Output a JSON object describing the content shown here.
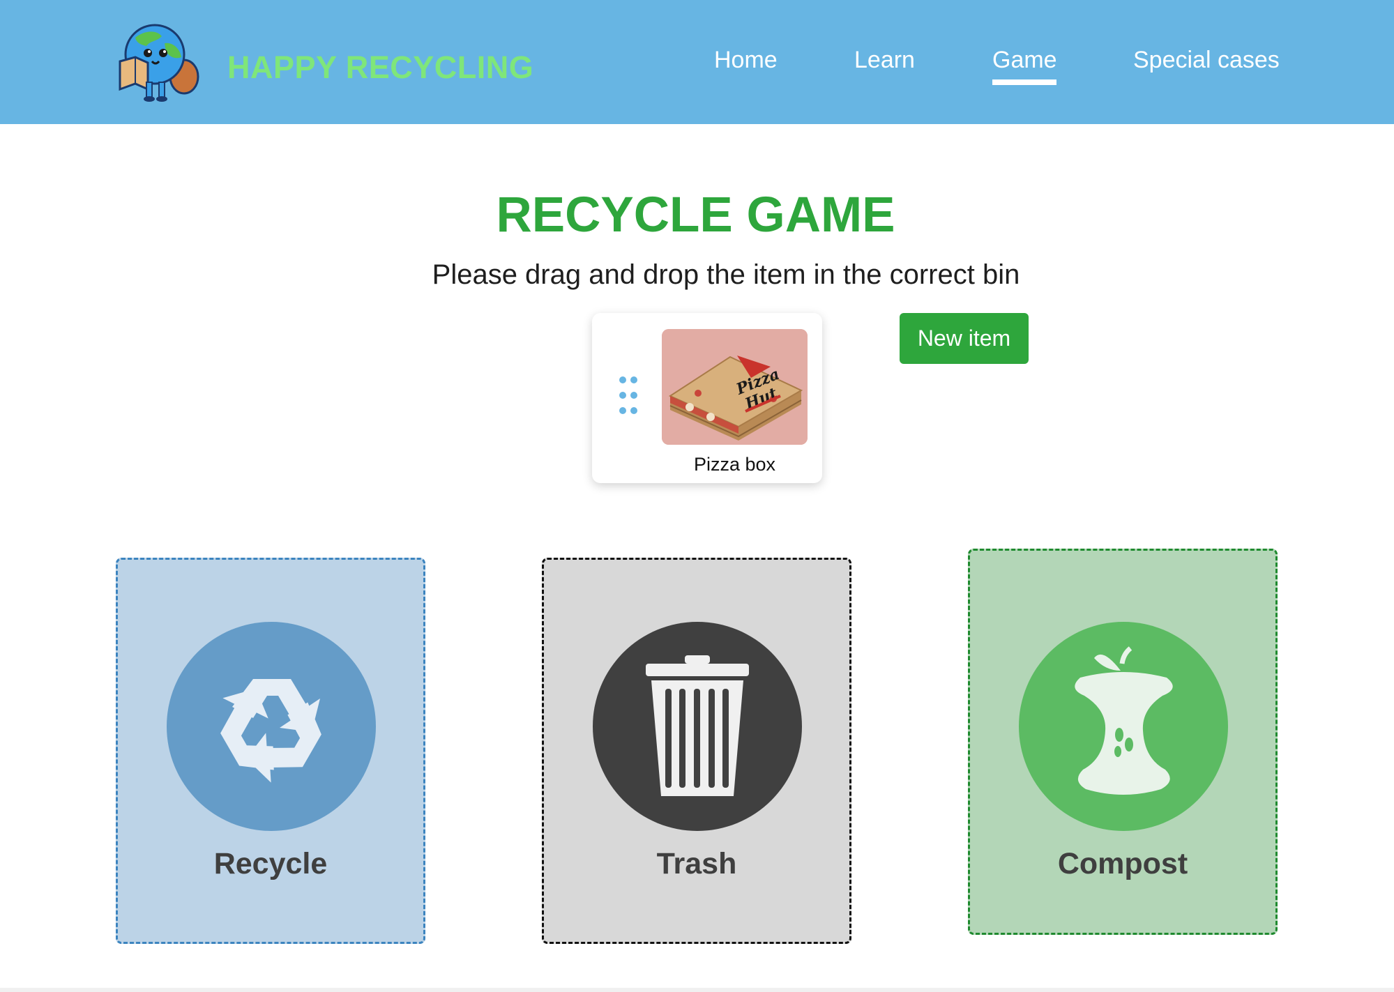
{
  "header": {
    "brand": "HAPPY RECYCLING",
    "logo_icon": "earth-mascot-with-map-icon",
    "nav": [
      {
        "label": "Home"
      },
      {
        "label": "Learn"
      },
      {
        "label": "Game"
      },
      {
        "label": "Special cases"
      }
    ],
    "active_nav": "Game"
  },
  "main": {
    "title": "RECYCLE GAME",
    "instruction": "Please drag and drop the item in the correct bin",
    "item": {
      "label": "Pizza box",
      "image": "pizza-box-image"
    },
    "new_item_button": "New item"
  },
  "bins": [
    {
      "label": "Recycle",
      "icon": "recycle-icon",
      "color": "#659cc8"
    },
    {
      "label": "Trash",
      "icon": "trash-can-icon",
      "color": "#404040"
    },
    {
      "label": "Compost",
      "icon": "apple-core-icon",
      "color": "#5cbb63"
    }
  ],
  "colors": {
    "header_bg": "#67b5e3",
    "brand": "#7fe67a",
    "title": "#2ea63c",
    "button": "#2ea63c"
  }
}
